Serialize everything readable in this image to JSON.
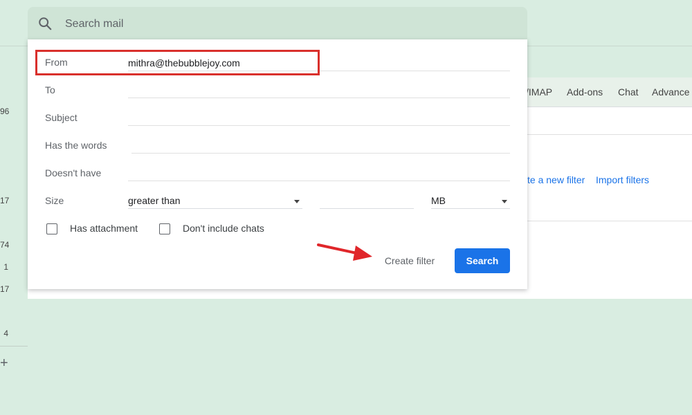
{
  "search": {
    "placeholder": "Search mail"
  },
  "sidebar": {
    "counts": [
      "96",
      "17",
      "74",
      "1",
      "17",
      "4"
    ]
  },
  "settings": {
    "tabs": [
      "/IMAP",
      "Add-ons",
      "Chat",
      "Advance"
    ],
    "links": {
      "create_new_filter": "te a new filter",
      "import_filters": "Import filters"
    }
  },
  "dialog": {
    "from": {
      "label": "From",
      "value": "mithra@thebubblejoy.com"
    },
    "to": {
      "label": "To",
      "value": ""
    },
    "subject": {
      "label": "Subject",
      "value": ""
    },
    "has_words": {
      "label": "Has the words",
      "value": ""
    },
    "doesnt_have": {
      "label": "Doesn't have",
      "value": ""
    },
    "size": {
      "label": "Size",
      "comparator": "greater than",
      "value": "",
      "unit": "MB"
    },
    "has_attachment": {
      "label": "Has attachment",
      "checked": false
    },
    "dont_include_chats": {
      "label": "Don't include chats",
      "checked": false
    },
    "create_filter_label": "Create filter",
    "search_label": "Search"
  },
  "colors": {
    "accent": "#1a73e8",
    "highlight": "#d9302c",
    "background": "#d9ede1"
  }
}
